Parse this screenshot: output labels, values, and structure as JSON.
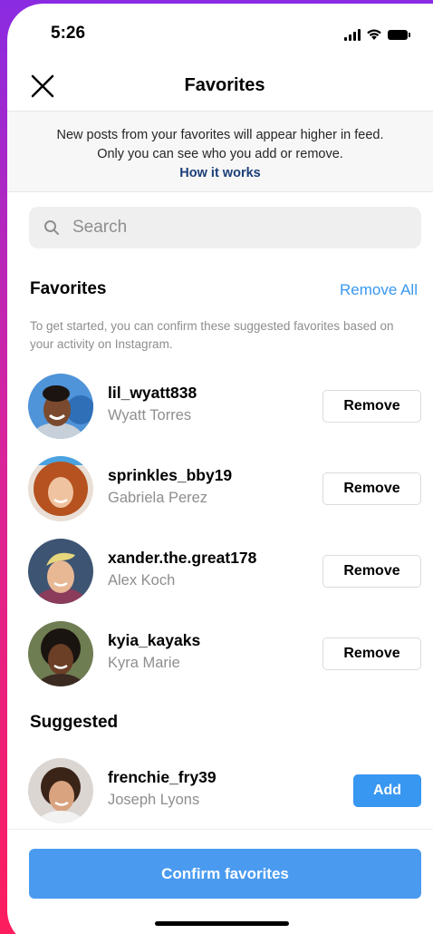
{
  "status_bar": {
    "time": "5:26"
  },
  "nav": {
    "title": "Favorites",
    "close_icon": "close-icon"
  },
  "banner": {
    "line1": "New posts from your favorites will appear higher in feed.",
    "line2": "Only you can see who you add or remove.",
    "link": "How it works"
  },
  "search": {
    "placeholder": "Search",
    "value": ""
  },
  "favorites": {
    "title": "Favorites",
    "remove_all": "Remove All",
    "hint": "To get started, you can confirm these suggested favorites based on your activity on Instagram.",
    "button_label": "Remove",
    "users": [
      {
        "username": "lil_wyatt838",
        "name": "Wyatt Torres"
      },
      {
        "username": "sprinkles_bby19",
        "name": "Gabriela Perez"
      },
      {
        "username": "xander.the.great178",
        "name": "Alex Koch"
      },
      {
        "username": "kyia_kayaks",
        "name": "Kyra Marie"
      }
    ]
  },
  "suggested": {
    "title": "Suggested",
    "button_label": "Add",
    "users": [
      {
        "username": "frenchie_fry39",
        "name": "Joseph Lyons"
      }
    ]
  },
  "footer": {
    "confirm_label": "Confirm favorites"
  },
  "colors": {
    "accent": "#3897f0",
    "link_dark": "#1b3f78",
    "secondary_text": "#8e8e8e"
  }
}
